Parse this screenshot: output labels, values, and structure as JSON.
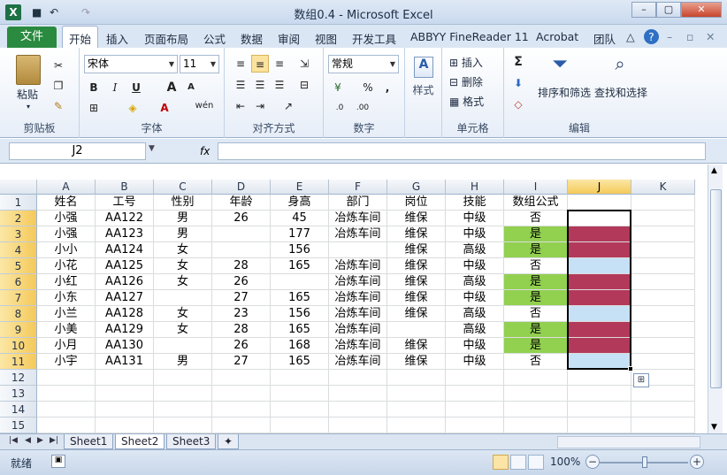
{
  "window": {
    "title": "数组0.4 - Microsoft Excel",
    "minimize": "–",
    "restore": "▢",
    "close": "✕"
  },
  "quick_access": {
    "save": "■",
    "undo": "↶",
    "redo": "↷"
  },
  "ribbon_tabs": {
    "file": "文件",
    "tabs": [
      "开始",
      "插入",
      "页面布局",
      "公式",
      "数据",
      "审阅",
      "视图",
      "开发工具",
      "ABBYY FineReader 11",
      "Acrobat",
      "团队"
    ]
  },
  "ribbon": {
    "clipboard": {
      "label": "剪贴板",
      "paste": "粘贴"
    },
    "font": {
      "label": "字体",
      "name": "宋体",
      "size": "11",
      "bold": "B",
      "italic": "I",
      "underline": "U",
      "grow": "A",
      "shrink": "A",
      "wen": "wén"
    },
    "alignment": {
      "label": "对齐方式"
    },
    "number": {
      "label": "数字",
      "format": "常规",
      "percent": "%",
      "comma": ","
    },
    "styles": {
      "label": "样式"
    },
    "cells": {
      "label": "单元格",
      "insert": "插入",
      "delete": "删除",
      "format": "格式"
    },
    "editing": {
      "label": "编辑",
      "sum": "Σ",
      "sort": "排序和筛选",
      "find": "查找和选择"
    }
  },
  "formula_bar": {
    "namebox": "J2",
    "fx": "fx",
    "formula": ""
  },
  "columns": [
    "A",
    "B",
    "C",
    "D",
    "E",
    "F",
    "G",
    "H",
    "I",
    "J",
    "K"
  ],
  "rows": [
    [
      "姓名",
      "工号",
      "性别",
      "年龄",
      "身高",
      "部门",
      "岗位",
      "技能",
      "数组公式",
      "",
      ""
    ],
    [
      "小强",
      "AA122",
      "男",
      "26",
      "45",
      "冶炼车间",
      "维保",
      "中级",
      "否",
      "",
      ""
    ],
    [
      "小强",
      "AA123",
      "男",
      "",
      "177",
      "冶炼车间",
      "维保",
      "中级",
      "是",
      "",
      ""
    ],
    [
      "小小",
      "AA124",
      "女",
      "",
      "156",
      "",
      "维保",
      "高级",
      "是",
      "",
      ""
    ],
    [
      "小花",
      "AA125",
      "女",
      "28",
      "165",
      "冶炼车间",
      "维保",
      "中级",
      "否",
      "",
      ""
    ],
    [
      "小红",
      "AA126",
      "女",
      "26",
      "",
      "冶炼车间",
      "维保",
      "高级",
      "是",
      "",
      ""
    ],
    [
      "小东",
      "AA127",
      "",
      "27",
      "165",
      "冶炼车间",
      "维保",
      "中级",
      "是",
      "",
      ""
    ],
    [
      "小兰",
      "AA128",
      "女",
      "23",
      "156",
      "冶炼车间",
      "维保",
      "高级",
      "否",
      "",
      ""
    ],
    [
      "小美",
      "AA129",
      "女",
      "28",
      "165",
      "冶炼车间",
      "",
      "高级",
      "是",
      "",
      ""
    ],
    [
      "小月",
      "AA130",
      "",
      "26",
      "168",
      "冶炼车间",
      "维保",
      "中级",
      "是",
      "",
      ""
    ],
    [
      "小宇",
      "AA131",
      "男",
      "27",
      "165",
      "冶炼车间",
      "维保",
      "中级",
      "否",
      "",
      ""
    ],
    [
      "",
      "",
      "",
      "",
      "",
      "",
      "",
      "",
      "",
      "",
      ""
    ],
    [
      "",
      "",
      "",
      "",
      "",
      "",
      "",
      "",
      "",
      "",
      ""
    ],
    [
      "",
      "",
      "",
      "",
      "",
      "",
      "",
      "",
      "",
      "",
      ""
    ],
    [
      "",
      "",
      "",
      "",
      "",
      "",
      "",
      "",
      "",
      "",
      ""
    ]
  ],
  "cell_fills": {
    "I": [
      null,
      null,
      "#92d050",
      "#92d050",
      null,
      "#92d050",
      "#92d050",
      null,
      "#92d050",
      "#92d050",
      null
    ],
    "J": [
      null,
      "#ffffff",
      "#b3395a",
      "#b3395a",
      "#c6e0f5",
      "#b3395a",
      "#b3395a",
      "#c6e0f5",
      "#b3395a",
      "#b3395a",
      "#c6e0f5"
    ]
  },
  "sheets": [
    "Sheet1",
    "Sheet2",
    "Sheet3"
  ],
  "active_sheet": "Sheet2",
  "status": {
    "mode": "就绪",
    "zoom": "100%"
  },
  "colors": {
    "file_tab": "#2a8a3f",
    "selection_header": "#f5c95a"
  }
}
